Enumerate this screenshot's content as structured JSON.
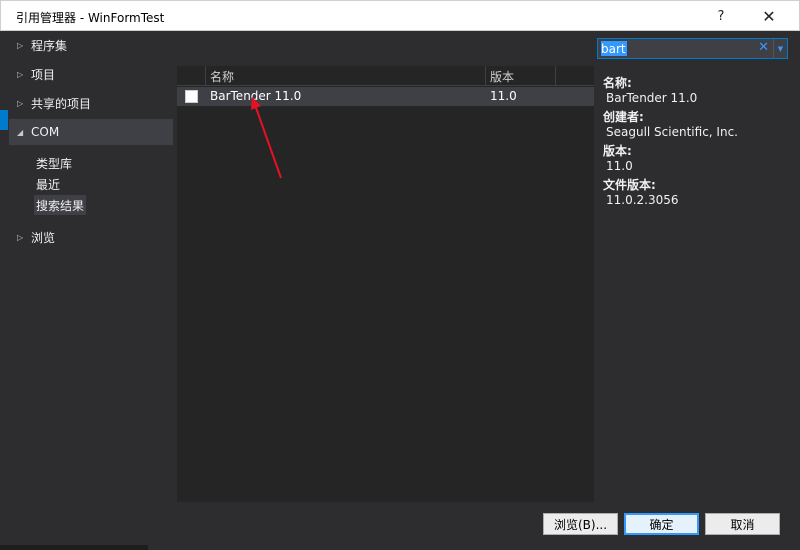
{
  "window": {
    "title": "引用管理器 - WinFormTest",
    "help_label": "?",
    "close_label": "✕"
  },
  "tree": {
    "items": [
      {
        "label": "程序集",
        "arrow": "▷"
      },
      {
        "label": "项目",
        "arrow": "▷"
      },
      {
        "label": "共享的项目",
        "arrow": "▷"
      },
      {
        "label": "COM",
        "arrow": "◢"
      },
      {
        "label": "浏览",
        "arrow": "▷"
      }
    ],
    "com_children": [
      "类型库",
      "最近",
      "搜索结果"
    ]
  },
  "list": {
    "columns": [
      "名称",
      "版本"
    ],
    "rows": [
      {
        "name": "BarTender 11.0",
        "version": "11.0",
        "checked": false
      }
    ]
  },
  "search": {
    "value": "bart",
    "clear_icon": "clear-icon",
    "dropdown_icon": "dropdown-arrow-icon"
  },
  "details": {
    "name_label": "名称:",
    "name_value": "BarTender 11.0",
    "creator_label": "创建者:",
    "creator_value": "Seagull Scientific, Inc.",
    "version_label": "版本:",
    "version_value": "11.0",
    "file_version_label": "文件版本:",
    "file_version_value": "11.0.2.3056"
  },
  "buttons": {
    "browse": "浏览(B)...",
    "ok": "确定",
    "cancel": "取消"
  },
  "colors": {
    "background": "#2d2d30",
    "panel": "#252526",
    "accent": "#007acc",
    "annotation_arrow": "#e81123"
  }
}
